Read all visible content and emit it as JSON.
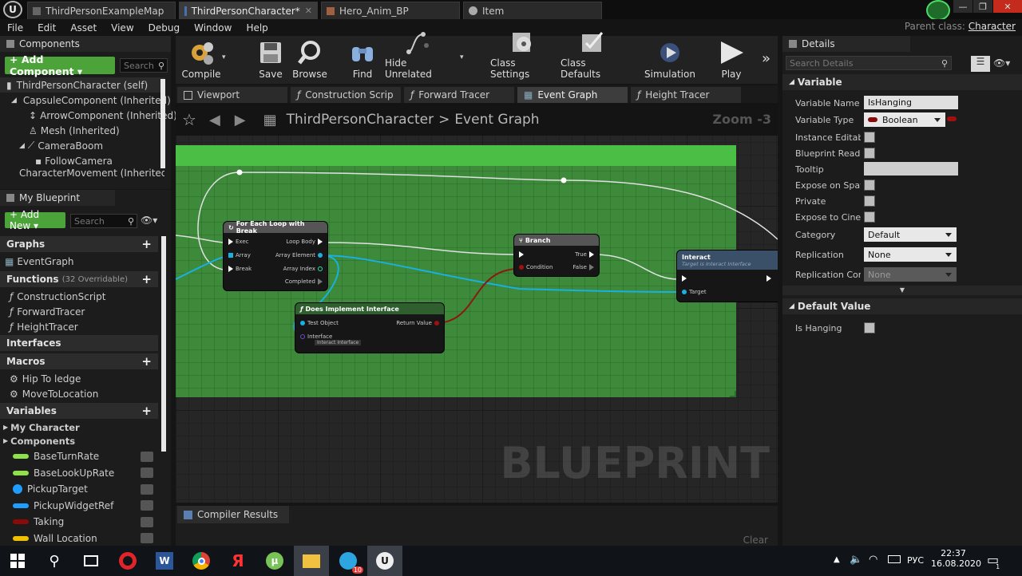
{
  "doc_tabs": [
    {
      "label": "ThirdPersonExampleMap",
      "icon": "map-icon"
    },
    {
      "label": "ThirdPersonCharacter*",
      "icon": "blueprint-icon"
    },
    {
      "label": "Hero_Anim_BP",
      "icon": "anim-icon"
    },
    {
      "label": "Item",
      "icon": "item-icon"
    }
  ],
  "menu": [
    "File",
    "Edit",
    "Asset",
    "View",
    "Debug",
    "Window",
    "Help"
  ],
  "parent_class": {
    "label": "Parent class:",
    "value": "Character"
  },
  "components": {
    "title": "Components",
    "add_label": "+ Add Component ▾",
    "search_placeholder": "Search",
    "items": [
      "ThirdPersonCharacter (self)",
      "CapsuleComponent (Inherited)",
      "ArrowComponent (Inherited)",
      "Mesh (Inherited)",
      "CameraBoom",
      "FollowCamera",
      "CharacterMovement (Inherited)"
    ]
  },
  "my_blueprint": {
    "title": "My Blueprint",
    "add_label": "+ Add New ▾",
    "search_placeholder": "Search",
    "graphs_label": "Graphs",
    "graphs": [
      "EventGraph"
    ],
    "functions_label": "Functions",
    "functions_count": "(32 Overridable)",
    "functions": [
      "ConstructionScript",
      "ForwardTracer",
      "HeightTracer"
    ],
    "interfaces_label": "Interfaces",
    "macros_label": "Macros",
    "macros": [
      "Hip To ledge",
      "MoveToLocation"
    ],
    "variables_label": "Variables",
    "categories": [
      "My Character",
      "Components"
    ],
    "variables": [
      {
        "name": "BaseTurnRate",
        "color": "#8fe04a"
      },
      {
        "name": "BaseLookUpRate",
        "color": "#8fe04a"
      },
      {
        "name": "PickupTarget",
        "color": "#1f9eff"
      },
      {
        "name": "PickupWidgetRef",
        "color": "#1f9eff"
      },
      {
        "name": "Taking",
        "color": "#8a0a0a"
      },
      {
        "name": "Wall Location",
        "color": "#f0c000"
      }
    ]
  },
  "toolbar": {
    "compile": "Compile",
    "save": "Save",
    "browse": "Browse",
    "find": "Find",
    "hide_unrelated": "Hide Unrelated",
    "class_settings": "Class Settings",
    "class_defaults": "Class Defaults",
    "simulation": "Simulation",
    "play": "Play"
  },
  "graph_tabs": [
    {
      "label": "Viewport",
      "icon": "viewport-icon"
    },
    {
      "label": "Construction Scrip",
      "icon": "function-icon"
    },
    {
      "label": "Forward Tracer",
      "icon": "function-icon"
    },
    {
      "label": "Event Graph",
      "icon": "graph-icon"
    },
    {
      "label": "Height Tracer",
      "icon": "function-icon"
    }
  ],
  "graph": {
    "breadcrumb_root": "ThirdPersonCharacter",
    "breadcrumb_sep": ">",
    "breadcrumb_leaf": "Event Graph",
    "zoom": "Zoom -3",
    "watermark": "BLUEPRINT",
    "nodes": {
      "foreach": {
        "title": "For Each Loop with Break",
        "in": [
          "Exec",
          "Array",
          "Break"
        ],
        "out": [
          "Loop Body",
          "Array Element",
          "Array Index",
          "Completed"
        ]
      },
      "branch": {
        "title": "Branch",
        "in": [
          "Condition"
        ],
        "out": [
          "True",
          "False"
        ]
      },
      "interact": {
        "title": "Interact",
        "subtitle": "Target is Interact Interface",
        "in": [
          "Target"
        ]
      },
      "implements": {
        "title": "Does Implement Interface",
        "in": [
          "Test Object",
          "Interface"
        ],
        "out": [
          "Return Value"
        ],
        "interface_value": "Interact Interface"
      }
    }
  },
  "compiler": {
    "tab": "Compiler Results",
    "clear": "Clear"
  },
  "details": {
    "title": "Details",
    "search_placeholder": "Search Details",
    "variable_section": "Variable",
    "variable_name_label": "Variable Name",
    "variable_name": "IsHanging",
    "variable_type_label": "Variable Type",
    "variable_type": "Boolean",
    "instance_editable": "Instance Editable",
    "bp_readonly": "Blueprint Read Only",
    "tooltip": "Tooltip",
    "expose_spawn": "Expose on Spawn",
    "private": "Private",
    "expose_cinematics": "Expose to Cinematics",
    "category_label": "Category",
    "category": "Default",
    "replication_label": "Replication",
    "replication": "None",
    "replication_cond_label": "Replication Condition",
    "replication_cond": "None",
    "default_section": "Default Value",
    "is_hanging": "Is Hanging"
  },
  "taskbar": {
    "language": "РУС",
    "time": "22:37",
    "date": "16.08.2020",
    "telegram_badge": "10",
    "notif_badge": "1"
  }
}
